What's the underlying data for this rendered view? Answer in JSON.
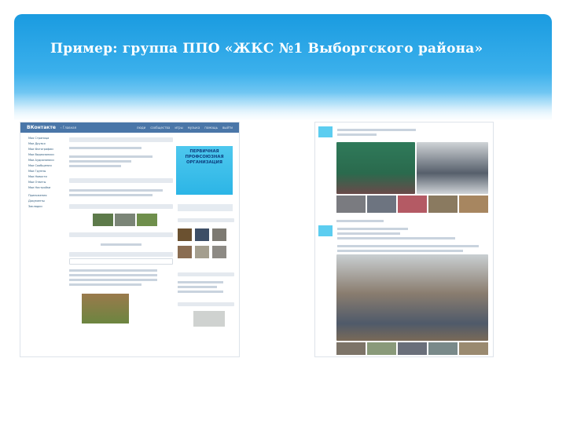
{
  "slide": {
    "title": "Пример: группа ППО «ЖКС №1 Выборгского района»"
  },
  "vk": {
    "logo": "ВКонтакте",
    "back": "‹ Главная",
    "nav": [
      "люди",
      "сообщества",
      "игры",
      "музыка",
      "помощь",
      "выйти"
    ],
    "menu": [
      "Моя Страница",
      "Мои Друзья",
      "Мои Фотографии",
      "Мои Видеозаписи",
      "Мои Аудиозаписи",
      "Мои Сообщения",
      "Мои Группы",
      "Мои Новости",
      "Мои Ответы",
      "Мои Настройки",
      "Приложения",
      "Документы",
      "Закладки"
    ],
    "poster": "ПЕРВИЧНАЯ ПРОФСОЮЗНАЯ ОРГАНИЗАЦИЯ",
    "colors": {
      "header": "#4a76a8",
      "poster": "#2cb5e6"
    }
  }
}
